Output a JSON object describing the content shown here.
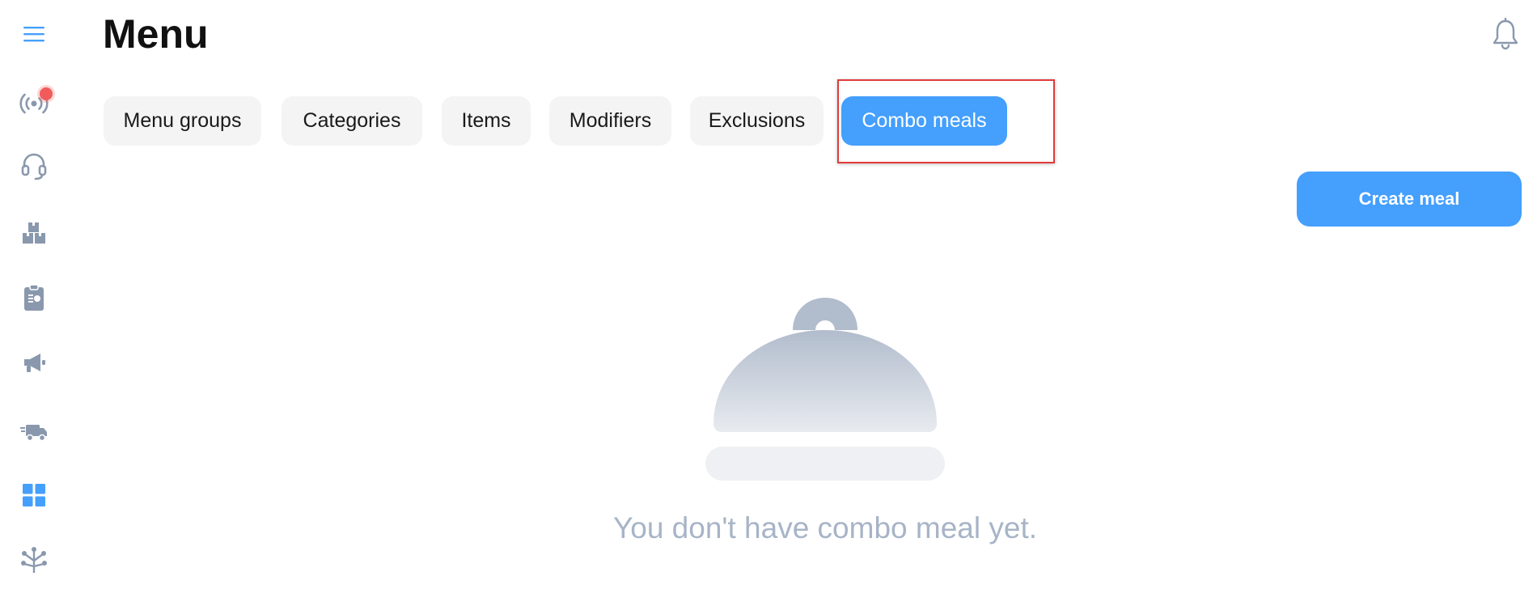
{
  "header": {
    "title": "Menu"
  },
  "sidebar": {
    "items": [
      {
        "icon": "hamburger-menu-icon",
        "color": "#449ffd"
      },
      {
        "icon": "broadcast-icon",
        "color": "#8a98ad",
        "has_notification_dot": true
      },
      {
        "icon": "headset-icon",
        "color": "#8a98ad"
      },
      {
        "icon": "boxes-icon",
        "color": "#8a98ad"
      },
      {
        "icon": "clipboard-icon",
        "color": "#8a98ad"
      },
      {
        "icon": "megaphone-icon",
        "color": "#8a98ad"
      },
      {
        "icon": "delivery-truck-icon",
        "color": "#8a98ad"
      },
      {
        "icon": "dashboard-grid-icon",
        "color": "#449ffd",
        "active": true
      },
      {
        "icon": "tree-network-icon",
        "color": "#8a98ad"
      }
    ]
  },
  "tabs": [
    {
      "label": "Menu groups"
    },
    {
      "label": "Categories"
    },
    {
      "label": "Items"
    },
    {
      "label": "Modifiers"
    },
    {
      "label": "Exclusions"
    },
    {
      "label": "Combo meals",
      "active": true
    }
  ],
  "actions": {
    "create_label": "Create meal"
  },
  "empty_state": {
    "icon": "food-cloche-icon",
    "message": "You don't have combo meal yet."
  },
  "colors": {
    "accent": "#449ffd",
    "tab_bg": "#f4f4f5",
    "muted_icon": "#8a98ad",
    "empty_text": "#a7b4c7",
    "notification": "#f25b5b",
    "highlight": "#e23a3a"
  }
}
